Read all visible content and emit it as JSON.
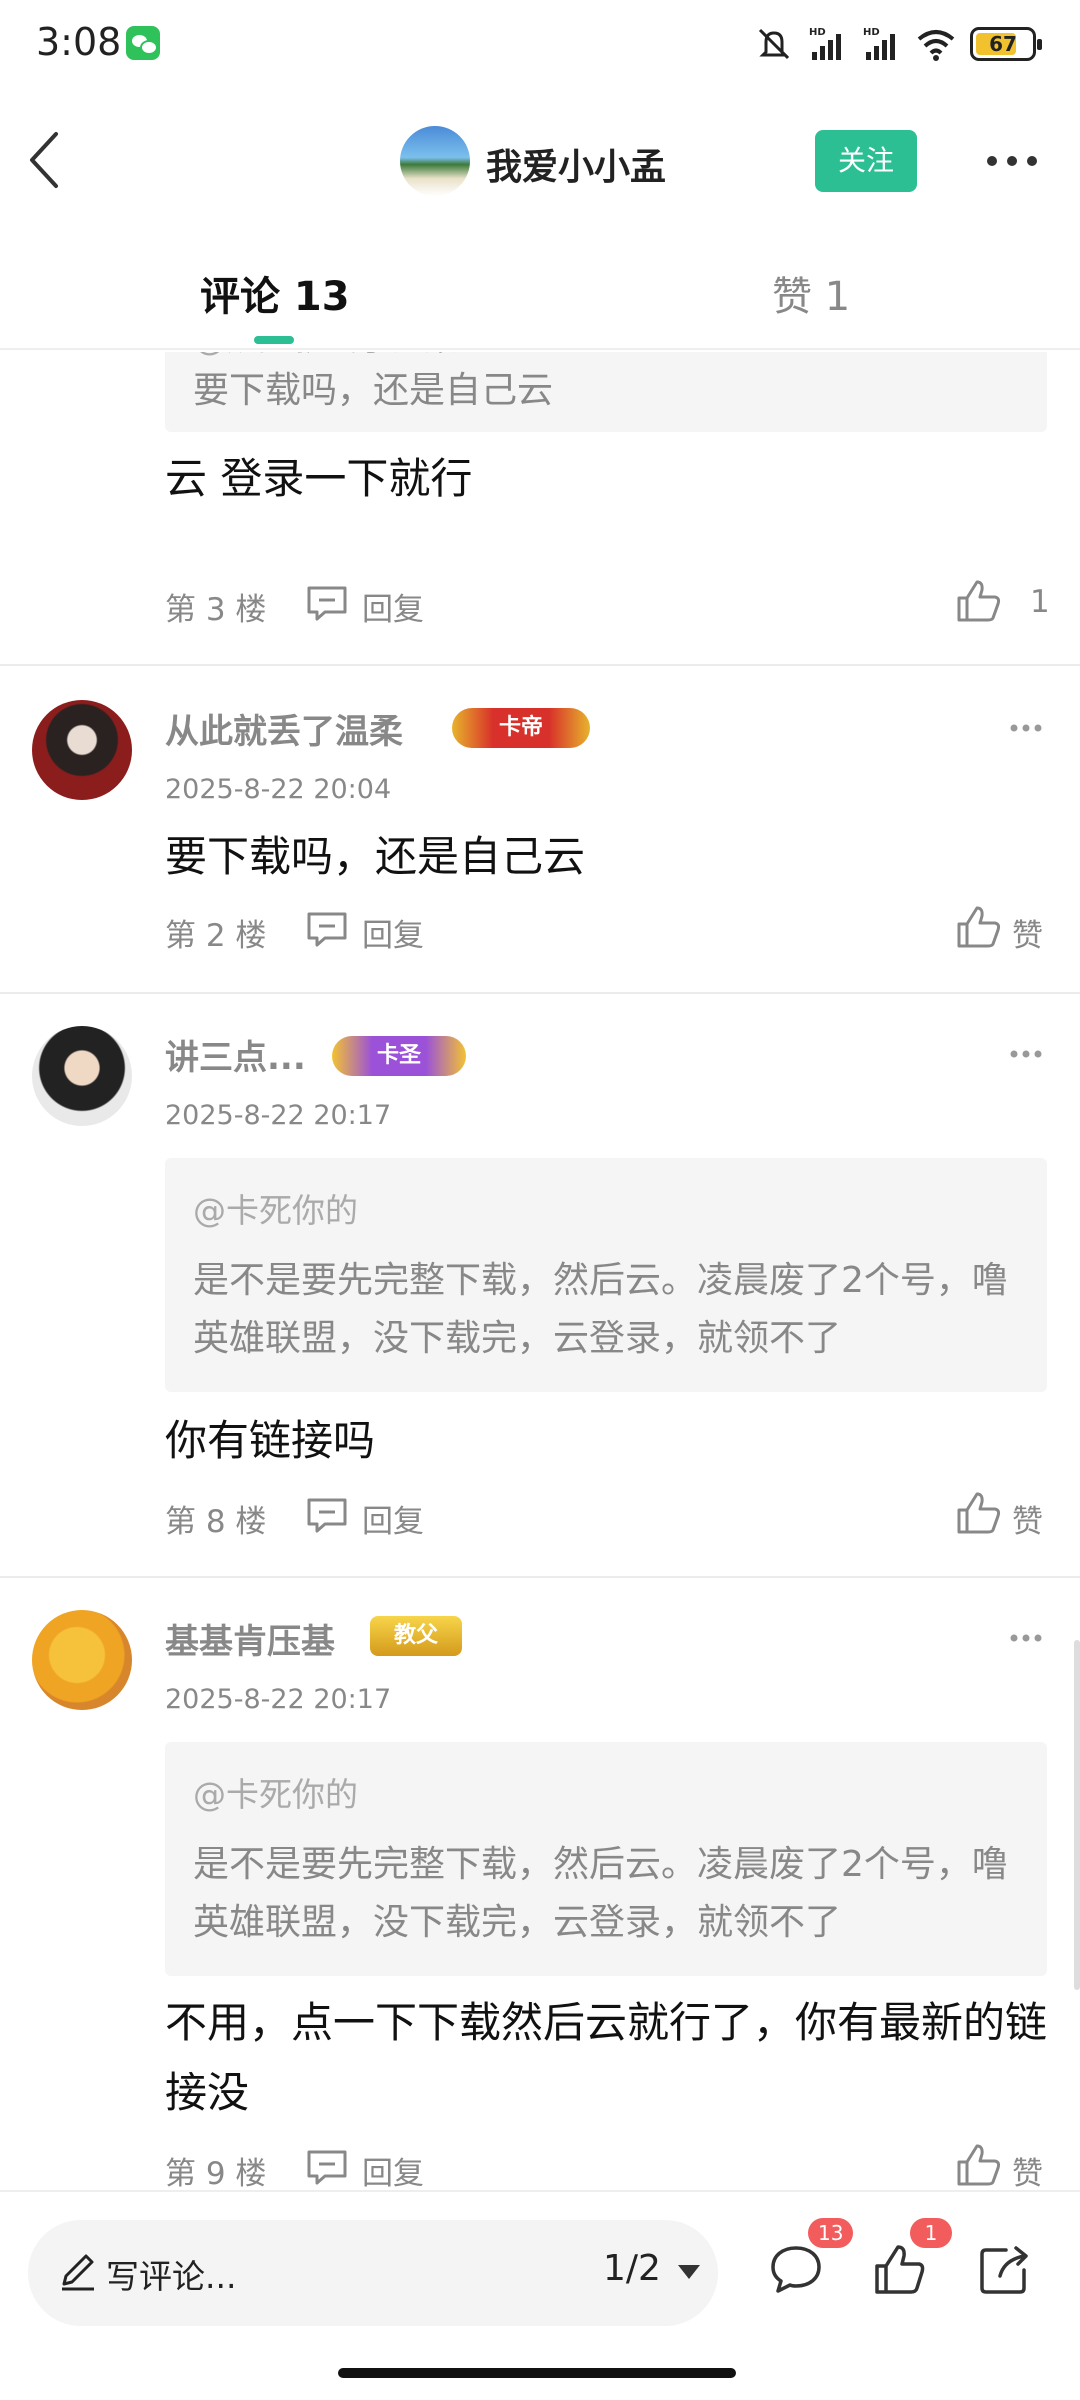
{
  "status_bar": {
    "time": "3:08",
    "battery": "67"
  },
  "header": {
    "title": "我爱小小孟",
    "follow_label": "关注"
  },
  "tabs": {
    "comments": "评论 13",
    "likes": "赞 1"
  },
  "partial_comment": {
    "quote_author": "@从此就丢了温柔",
    "quote_text": "要下载吗，还是自己云",
    "text": "云  登录一下就行",
    "floor": "第 3 楼",
    "reply": "回复",
    "likes": "1"
  },
  "comments": [
    {
      "username": "从此就丢了温柔",
      "badge": "卡帝",
      "time": "2025-8-22 20:04",
      "text": "要下载吗，还是自己云",
      "floor": "第 2 楼",
      "reply": "回复",
      "like": "赞"
    },
    {
      "username": "讲三点...",
      "badge": "卡圣",
      "time": "2025-8-22 20:17",
      "quote_author": "@卡死你的",
      "quote_text": "是不是要先完整下载，然后云。凌晨废了2个号，噜英雄联盟，没下载完，云登录，就领不了",
      "text": "你有链接吗",
      "floor": "第 8 楼",
      "reply": "回复",
      "like": "赞"
    },
    {
      "username": "基基肯压基",
      "badge": "教父",
      "time": "2025-8-22 20:17",
      "quote_author": "@卡死你的",
      "quote_text": "是不是要先完整下载，然后云。凌晨废了2个号，噜英雄联盟，没下载完，云登录，就领不了",
      "text": "不用，点一下下载然后云就行了，你有最新的链接没",
      "floor": "第 9 楼",
      "reply": "回复",
      "like": "赞"
    }
  ],
  "bottom_bar": {
    "placeholder": "写评论...",
    "page": "1/2",
    "comment_count": "13",
    "like_count": "1"
  },
  "colors": {
    "accent": "#2bbf93",
    "badge_red": "#f25c5c"
  }
}
